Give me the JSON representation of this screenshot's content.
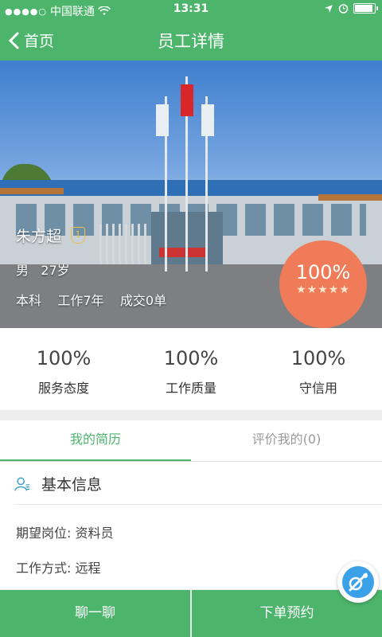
{
  "status_bar": {
    "carrier": "中国联通",
    "time": "13:31",
    "battery_percent": 90
  },
  "nav": {
    "back_label": "首页",
    "title": "员工详情"
  },
  "profile": {
    "name": "朱方超",
    "gender": "男",
    "age": "27岁",
    "education": "本科",
    "experience": "工作7年",
    "deals": "成交0单",
    "rating_percent": "100%",
    "stars": "★★★★★"
  },
  "stats": [
    {
      "value": "100%",
      "label": "服务态度"
    },
    {
      "value": "100%",
      "label": "工作质量"
    },
    {
      "value": "100%",
      "label": "守信用"
    }
  ],
  "tabs": [
    {
      "label": "我的简历"
    },
    {
      "label": "评价我的(0)"
    }
  ],
  "basic_info": {
    "title": "基本信息",
    "position_label": "期望岗位:",
    "position_value": "资料员",
    "work_mode_label": "工作方式:",
    "work_mode_value": "远程"
  },
  "bottom_bar": {
    "chat_label": "聊一聊",
    "order_label": "下单预约"
  },
  "colors": {
    "brand_green": "#4cb56b",
    "rating_orange": "#ef7b58",
    "float_blue": "#3aa0e8"
  }
}
